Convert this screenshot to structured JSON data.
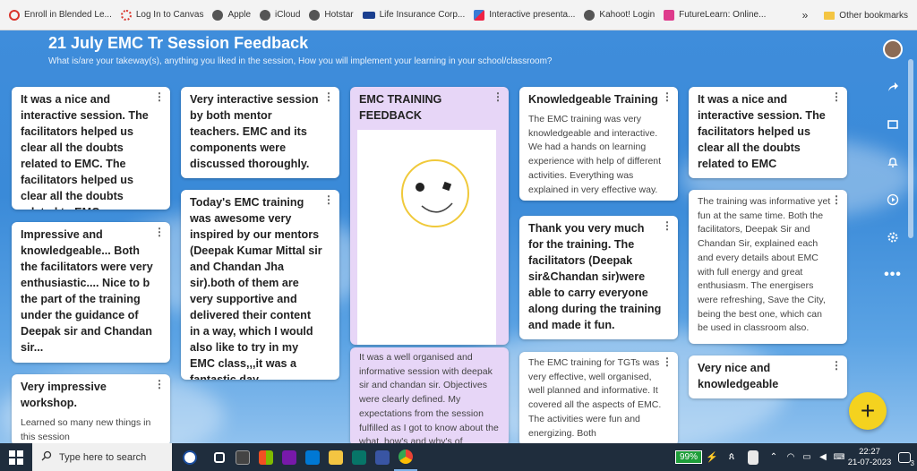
{
  "bookmarks": [
    {
      "label": "Enroll in Blended Le...",
      "icon": "loading-ring-icon",
      "color": "#d9342b"
    },
    {
      "label": "Log In to Canvas",
      "icon": "canvas-icon",
      "color": "#d9342b"
    },
    {
      "label": "Apple",
      "icon": "globe-icon",
      "color": "#555555"
    },
    {
      "label": "iCloud",
      "icon": "globe-icon",
      "color": "#555555"
    },
    {
      "label": "Hotstar",
      "icon": "globe-icon",
      "color": "#555555"
    },
    {
      "label": "Life Insurance Corp...",
      "icon": "lic-icon",
      "color": "#1a3f8f"
    },
    {
      "label": "Interactive presenta...",
      "icon": "chart-icon",
      "color": "#3a7bd5"
    },
    {
      "label": "Kahoot! Login",
      "icon": "globe-icon",
      "color": "#555555"
    },
    {
      "label": "FutureLearn: Online...",
      "icon": "futurelearn-icon",
      "color": "#de3b8c"
    }
  ],
  "bookmarks_more": "»",
  "other_bookmarks": "Other bookmarks",
  "board": {
    "title": "21 July EMC Tr Session Feedback",
    "subtitle": "What is/are your takeway(s), anything you liked in the session, How you will implement your learning in your school/classroom?"
  },
  "cards": {
    "c1": {
      "heading": "It was a nice and interactive session. The facilitators helped us clear all the doubts related to EMC. The facilitators helped us clear all the doubts related to EMC."
    },
    "c2": {
      "heading": "Impressive and knowledgeable... Both the facilitators were very enthusiastic.... Nice to b the part of the training under the guidance of Deepak sir and Chandan sir..."
    },
    "c3": {
      "heading": "Very impressive workshop.",
      "body": "Learned so many new things in this session"
    },
    "c4": {
      "heading": "Very interactive session by both mentor teachers. EMC and its components were discussed thoroughly."
    },
    "c5": {
      "heading": "Today's EMC training was awesome very inspired by our mentors (Deepak Kumar Mittal sir and Chandan Jha sir).both of them are very supportive and delivered their content in a way, which I would also like to try in my EMC class,,,it was a fantastic day.."
    },
    "c6": {
      "heading": "EMC TRAINING FEEDBACK"
    },
    "c7": {
      "body": "It was a well organised and informative session with deepak sir and chandan sir. Objectives were clearly defined. My expectations from the session fulfilled as I got to know about the what, how's and why's of"
    },
    "c8": {
      "heading": "Knowledgeable Training",
      "body": "The EMC training was very knowledgeable and interactive. We had a hands on learning experience with help of different activities. Everything was explained in very effective way."
    },
    "c9": {
      "heading": "Thank you very much for the training. The facilitators (Deepak sir&Chandan sir)were able to carry everyone along during the training and made it fun."
    },
    "c10": {
      "body": "The EMC training for TGTs was very effective, well organised, well planned and informative. It covered all the aspects of EMC. The activities were fun and energizing. Both"
    },
    "c11": {
      "heading": "It was a nice and interactive session. The facilitators helped us clear all the doubts related to EMC"
    },
    "c12": {
      "body": "The training was informative yet fun at the same time. Both the facilitators, Deepak Sir and Chandan Sir, explained each and every details about EMC with full energy and great enthusiasm. The energisers were refreshing, Save the City, being the best one, which can be used in classroom also."
    },
    "c13": {
      "heading": "Very nice and knowledgeable"
    }
  },
  "fab_label": "+",
  "taskbar": {
    "search_placeholder": "Type here to search",
    "battery": "99%",
    "time": "22:27",
    "date": "21-07-2023",
    "notification_count": "3"
  },
  "colors": {
    "board_blue": "#3f8ddb",
    "card_purple": "#e7d6f7",
    "fab_yellow": "#f4d21f",
    "taskbar": "#1f2d3d"
  }
}
